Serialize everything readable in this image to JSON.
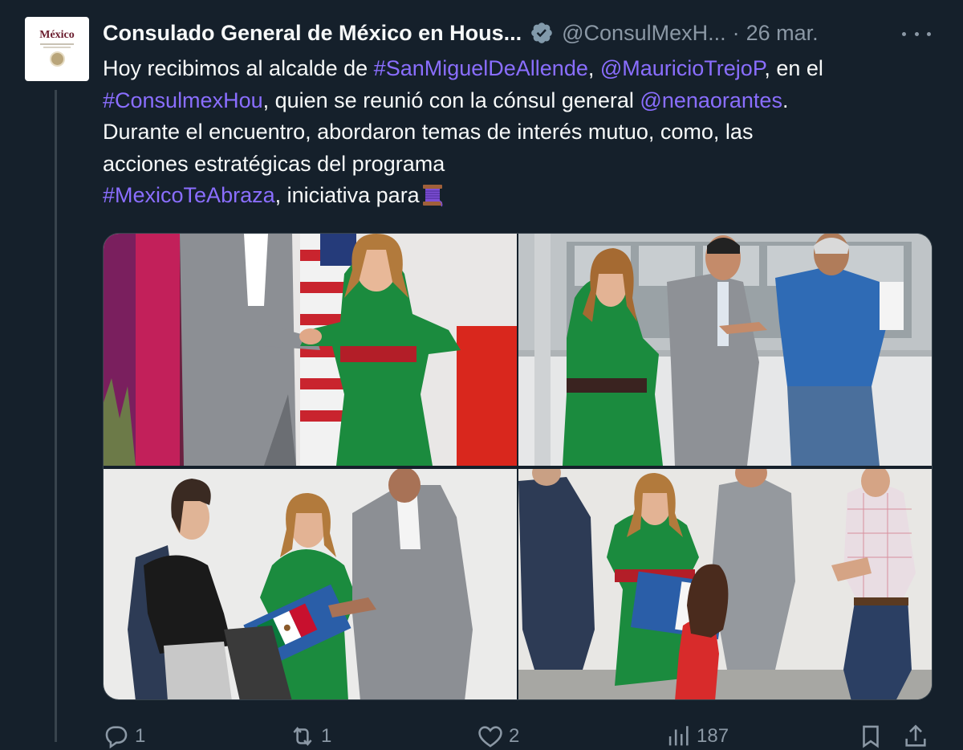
{
  "tweet": {
    "display_name": "Consulado General de México en Hous...",
    "handle": "@ConsulMexH...",
    "separator": "·",
    "date": "26 mar.",
    "avatar_text": "México",
    "text_segments": {
      "l1_a": "Hoy recibimos al alcalde de ",
      "l1_link1": "#SanMiguelDeAllende",
      "l1_b": ", ",
      "l1_link2": "@MauricioTrejoP",
      "l1_c": ", en el",
      "l2_link1": "#ConsulmexHou",
      "l2_a": ", quien se reunió con la cónsul general ",
      "l2_link2": "@nenaorantes",
      "l2_b": ".",
      "l3": "Durante el encuentro, abordaron temas de interés mutuo, como, las",
      "l4": "acciones estratégicas del programa",
      "l5_link": " #MexicoTeAbraza",
      "l5_a": ", iniciativa para"
    },
    "emoji_name": "thread-spool-emoji",
    "media": [
      {
        "name": "photo-handshake"
      },
      {
        "name": "photo-office-greeting"
      },
      {
        "name": "photo-flag-folder"
      },
      {
        "name": "photo-certificate-girl"
      }
    ],
    "actions": {
      "reply_count": "1",
      "retweet_count": "1",
      "like_count": "2",
      "views_count": "187"
    }
  },
  "colors": {
    "background": "#15202b",
    "link": "#8a6eff",
    "secondary_text": "#8b98a5",
    "verified_badge": "#829aab"
  }
}
